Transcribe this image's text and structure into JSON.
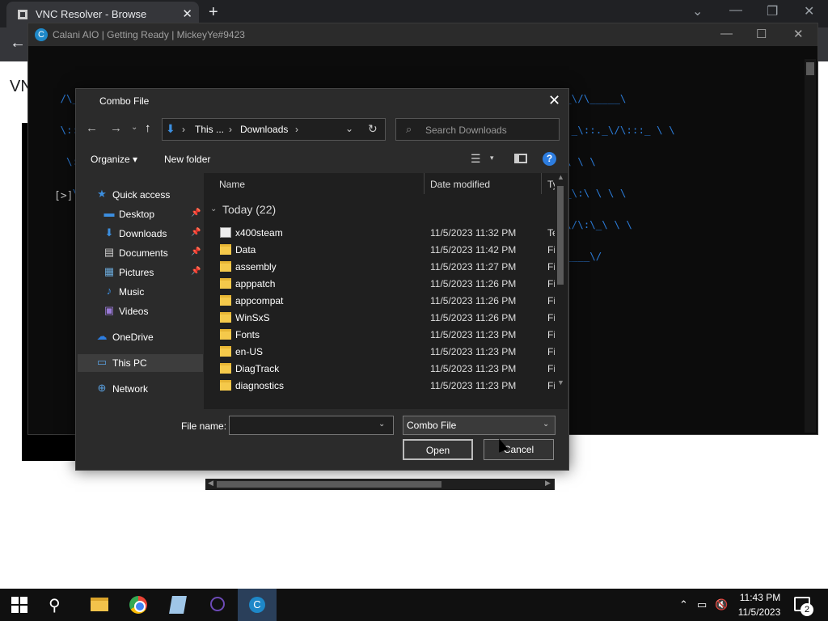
{
  "browser": {
    "tab_title": "VNC Resolver - Browse",
    "tab_close": "✕",
    "new_tab": "+",
    "back": "←",
    "page_text": "VN",
    "controls": {
      "dropdown": "⌄",
      "minimize": "—",
      "restore": "❐",
      "close": "✕"
    }
  },
  "console": {
    "title": "Calani AIO | Getting Ready | MickeyYe#9423",
    "icon_letter": "C",
    "prompt": "[>]",
    "controls": {
      "minimize": "—",
      "maximize": "☐",
      "close": "✕"
    },
    "ascii_lines": [
      " /\\_____\\  /\\______\\ /\\_\\      /\\_______\\ /\\__\\ /\\__\\ /\\______\\    /\\______\\ /\\______\\/\\_____\\",
      " \\::'____'\\ \\::::::::\\ \\::\\      \\:::::::::\\ \\:::\\ \\:::\\ \\:::::::::\\    \\::::::::\\ \\:_\\::._\\/\\:::_ \\ \\",
      "  \\::\\ \\   \\::\\ \\::\\ \\::\\ \\     \\::\\ \\::\\ \\::\\ \\::\\ \\::\\ \\::\\    \\::\\ \\  \\:\\ \\  \\:\\ \\ \\ \\",
      "   \\::\\ \\   \\::\\_\\::\\ \\::\\ \\____  \\::\\_\\::\\ \\::\\ \\::\\ \\::\\_\\::\\    \\::\\_\\  \\__::\\_\\__\\:\\ \\ \\ \\",
      "    \\::\\ \\___\\::\\ \\::\\ \\::\\/___/\\ \\::\\ \\::\\ \\::\\ \\::\\ \\::\\ \\::\\    \\::\\ \\::\\/__\\::\\:\\/\\:\\_\\ \\ \\",
      "     \\:\\_____\\:\\_\\::\\_\\::\\_____\\ \\:\\_\\::\\_\\:\\_\\::\\_\\:\\_\\::\\_\\    \\:\\_\\:\\_______\\/ \\_____\\/"
    ]
  },
  "dialog": {
    "title": "Combo File",
    "close": "✕",
    "nav": {
      "back": "←",
      "forward": "→",
      "recent": "⌄",
      "up": "↑"
    },
    "address": {
      "icon": "⬇",
      "sep": "›",
      "crumbs": [
        "This ...",
        "Downloads"
      ],
      "dropdown": "⌄",
      "refresh": "↻"
    },
    "search": {
      "icon": "⌕",
      "placeholder": "Search Downloads"
    },
    "commands": {
      "organize": "Organize ▾",
      "new_folder": "New folder",
      "view_icon": "☰",
      "view_dd": "▾",
      "help": "?"
    },
    "nav_pane": {
      "pin": "📌",
      "items": [
        {
          "label": "Quick access",
          "icon": "★",
          "color": "#3c8fe0",
          "pinned": false
        },
        {
          "label": "Desktop",
          "icon": "▬",
          "color": "#3c8fe0",
          "pinned": true
        },
        {
          "label": "Downloads",
          "icon": "⬇",
          "color": "#3c8fe0",
          "pinned": true
        },
        {
          "label": "Documents",
          "icon": "▤",
          "color": "#cccccc",
          "pinned": true
        },
        {
          "label": "Pictures",
          "icon": "▦",
          "color": "#6aa8d8",
          "pinned": true
        },
        {
          "label": "Music",
          "icon": "♪",
          "color": "#3c8fe0",
          "pinned": false
        },
        {
          "label": "Videos",
          "icon": "▣",
          "color": "#9a7ad8",
          "pinned": false
        },
        {
          "label": "OneDrive",
          "icon": "☁",
          "color": "#2d7de0",
          "pinned": false
        },
        {
          "label": "This PC",
          "icon": "▭",
          "color": "#5aa0e0",
          "pinned": false
        },
        {
          "label": "Network",
          "icon": "⊕",
          "color": "#5aa0e0",
          "pinned": false
        }
      ]
    },
    "columns": {
      "name": "Name",
      "date": "Date modified",
      "type": "Ty"
    },
    "group": {
      "label": "Today (22)",
      "chevron": "⌄"
    },
    "files": [
      {
        "name": "x400steam",
        "date": "11/5/2023 11:32 PM",
        "type": "Te",
        "kind": "doc"
      },
      {
        "name": "Data",
        "date": "11/5/2023 11:42 PM",
        "type": "Fi",
        "kind": "folder"
      },
      {
        "name": "assembly",
        "date": "11/5/2023 11:27 PM",
        "type": "Fi",
        "kind": "folder"
      },
      {
        "name": "apppatch",
        "date": "11/5/2023 11:26 PM",
        "type": "Fi",
        "kind": "folder"
      },
      {
        "name": "appcompat",
        "date": "11/5/2023 11:26 PM",
        "type": "Fi",
        "kind": "folder"
      },
      {
        "name": "WinSxS",
        "date": "11/5/2023 11:26 PM",
        "type": "Fi",
        "kind": "folder"
      },
      {
        "name": "Fonts",
        "date": "11/5/2023 11:23 PM",
        "type": "Fi",
        "kind": "folder"
      },
      {
        "name": "en-US",
        "date": "11/5/2023 11:23 PM",
        "type": "Fi",
        "kind": "folder"
      },
      {
        "name": "DiagTrack",
        "date": "11/5/2023 11:23 PM",
        "type": "Fi",
        "kind": "folder"
      },
      {
        "name": "diagnostics",
        "date": "11/5/2023 11:23 PM",
        "type": "Fi",
        "kind": "folder"
      }
    ],
    "scroll": {
      "up": "▲",
      "down": "▼",
      "left": "◀",
      "right": "▶"
    },
    "filename": {
      "label": "File name:",
      "value": "",
      "dd": "⌄"
    },
    "filetype": {
      "value": "Combo File",
      "dd": "⌄"
    },
    "buttons": {
      "open": "Open",
      "cancel": "Cancel"
    }
  },
  "taskbar": {
    "search": "⚲",
    "calani_letter": "C",
    "tray": {
      "chevron": "⌃",
      "network": "▭",
      "volume": "🔇",
      "time": "11:43 PM",
      "date": "11/5/2023",
      "notif_count": "2"
    }
  }
}
